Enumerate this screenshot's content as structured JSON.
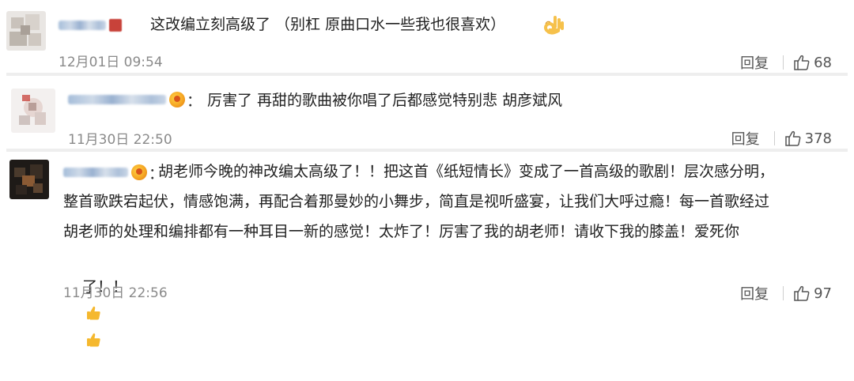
{
  "comments": [
    {
      "text": "这改编立刻高级了 （别杠 原曲口水一些我也很喜欢）",
      "time": "12月01日 09:54",
      "reply_label": "回复",
      "likes": "68",
      "emoji": "ok-hand-icon"
    },
    {
      "text": "厉害了 再甜的歌曲被你唱了后都感觉特别悲 胡彦斌风",
      "time": "11月30日 22:50",
      "reply_label": "回复",
      "likes": "378"
    },
    {
      "lines": [
        "胡老师今晚的神改编太高级了！！把这首《纸短情长》变成了一首高级的歌剧！层次感分明，",
        "整首歌跌宕起伏，情感饱满，再配合着那曼妙的小舞步，简直是视听盛宴，让我们大呼过瘾！每一首歌经过",
        "胡老师的处理和编排都有一种耳目一新的感觉！太炸了！厉害了我的胡老师！请收下我的膝盖！爱死你",
        "了！！"
      ],
      "time": "11月30日 22:56",
      "reply_label": "回复",
      "likes": "97",
      "emoji": "thumbs-up-icon"
    }
  ],
  "colors": {
    "text": "#222222",
    "meta": "#8a8a8a",
    "separator": "#eeeeee",
    "badge": "#f5a623"
  }
}
